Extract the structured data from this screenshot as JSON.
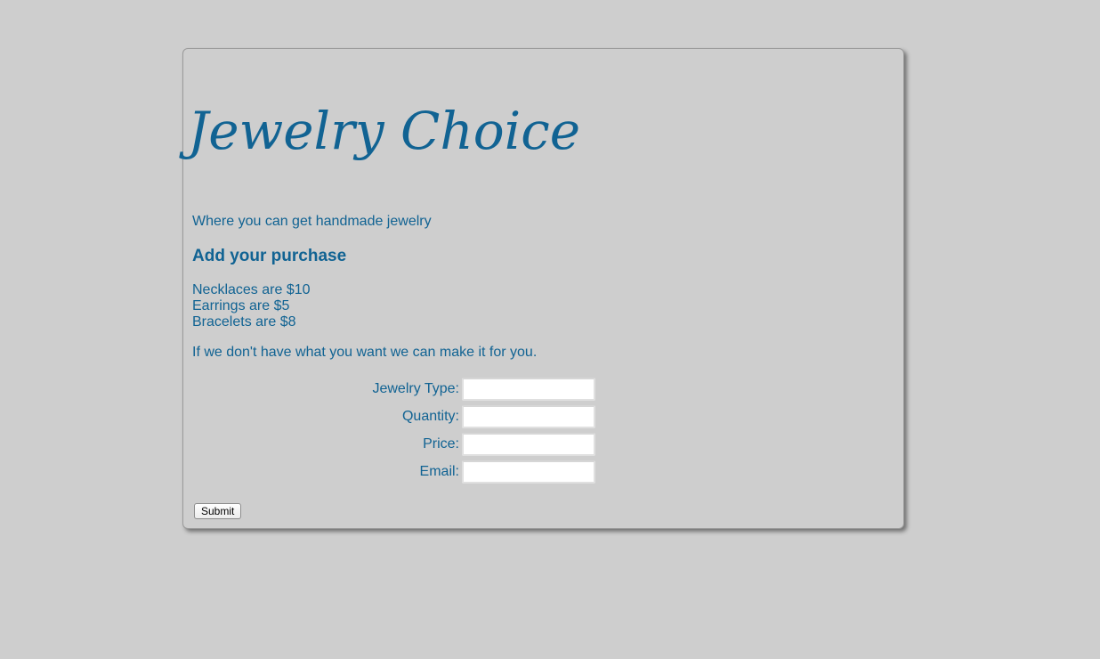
{
  "header": {
    "title": "Jewelry Choice",
    "tagline": "Where you can get handmade jewelry"
  },
  "purchase": {
    "heading": "Add your purchase",
    "prices": [
      "Necklaces are $10",
      "Earrings are $5",
      "Bracelets are $8"
    ],
    "custom_note": "If we don't have what you want we can make it for you."
  },
  "form": {
    "fields": [
      {
        "label": "Jewelry Type:",
        "value": ""
      },
      {
        "label": "Quantity:",
        "value": ""
      },
      {
        "label": "Price:",
        "value": ""
      },
      {
        "label": "Email:",
        "value": ""
      }
    ],
    "submit_label": "Submit"
  },
  "colors": {
    "accent": "#116393",
    "background": "#cecece"
  }
}
